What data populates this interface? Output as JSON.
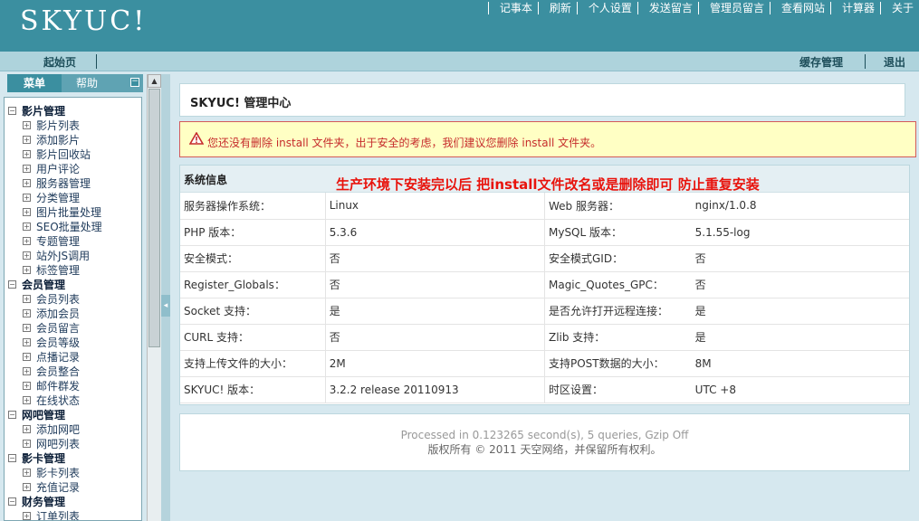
{
  "header": {
    "logo": "SKYUC!",
    "nav": [
      "记事本",
      "刷新",
      "个人设置",
      "发送留言",
      "管理员留言",
      "查看网站",
      "计算器",
      "关于"
    ]
  },
  "subbar": {
    "start": "起始页",
    "cache": "缓存管理",
    "logout": "退出"
  },
  "sidebar": {
    "tab_menu": "菜单",
    "tab_help": "帮助",
    "groups": [
      {
        "label": "影片管理",
        "items": [
          "影片列表",
          "添加影片",
          "影片回收站",
          "用户评论",
          "服务器管理",
          "分类管理",
          "图片批量处理",
          "SEO批量处理",
          "专题管理",
          "站外JS调用",
          "标签管理"
        ]
      },
      {
        "label": "会员管理",
        "items": [
          "会员列表",
          "添加会员",
          "会员留言",
          "会员等级",
          "点播记录",
          "会员整合",
          "邮件群发",
          "在线状态"
        ]
      },
      {
        "label": "网吧管理",
        "items": [
          "添加网吧",
          "网吧列表"
        ]
      },
      {
        "label": "影卡管理",
        "items": [
          "影卡列表",
          "充值记录"
        ]
      },
      {
        "label": "财务管理",
        "items": [
          "订单列表"
        ]
      }
    ]
  },
  "main": {
    "title": "SKYUC! 管理中心",
    "warning": "您还没有删除 install 文件夹，出于安全的考虑，我们建议您删除 install 文件夹。",
    "sysinfo": {
      "header": "系统信息",
      "note": "生产环境下安装完以后  把install文件改名或是删除即可  防止重复安装",
      "rows": [
        [
          "服务器操作系统：",
          "Linux",
          "Web 服务器：",
          "nginx/1.0.8"
        ],
        [
          "PHP 版本：",
          "5.3.6",
          "MySQL 版本：",
          "5.1.55-log"
        ],
        [
          "安全模式：",
          "否",
          "安全模式GID：",
          "否"
        ],
        [
          "Register_Globals：",
          "否",
          "Magic_Quotes_GPC：",
          "否"
        ],
        [
          "Socket 支持：",
          "是",
          "是否允许打开远程连接：",
          "是"
        ],
        [
          "CURL 支持：",
          "否",
          "Zlib 支持：",
          "是"
        ],
        [
          "支持上传文件的大小：",
          "2M",
          "支持POST数据的大小：",
          "8M"
        ],
        [
          "SKYUC! 版本：",
          "3.2.2 release 20110913",
          "时区设置：",
          "UTC +8"
        ]
      ]
    },
    "footer": {
      "line1": "Processed in 0.123265 second(s), 5 queries, Gzip Off",
      "line2": "版权所有 © 2011 天空网络，并保留所有权利。"
    }
  }
}
